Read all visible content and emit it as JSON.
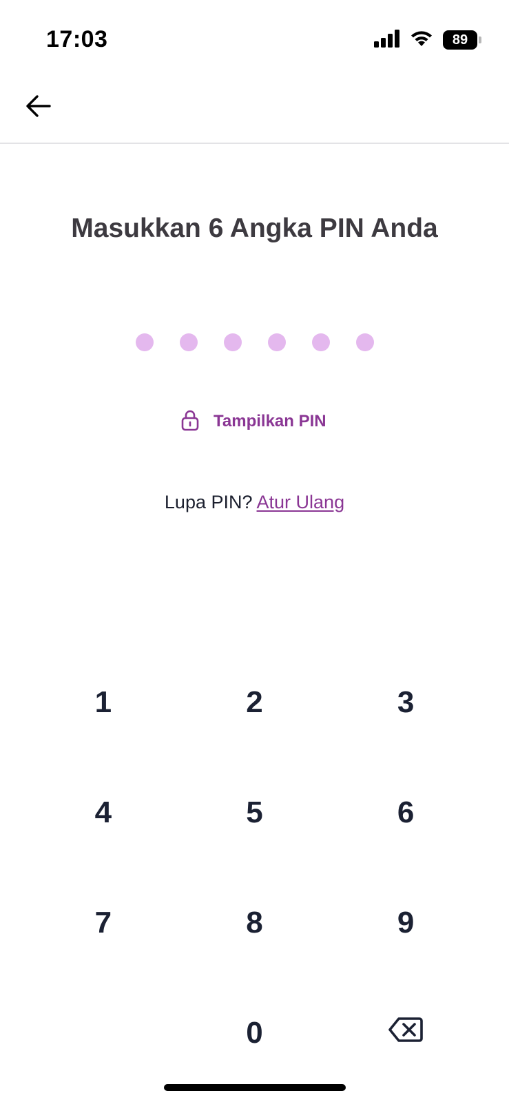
{
  "status_bar": {
    "time": "17:03",
    "battery_level": "89",
    "icons": [
      "signal-icon",
      "wifi-icon",
      "battery-icon"
    ]
  },
  "header": {
    "back_icon": "arrow-left-icon"
  },
  "title": "Masukkan 6 Angka PIN Anda",
  "pin": {
    "length": 6,
    "entered": 0,
    "dot_color": "#e4b8ee"
  },
  "show_pin": {
    "icon": "lock-icon",
    "label": "Tampilkan PIN"
  },
  "forgot": {
    "text": "Lupa PIN?",
    "link_label": "Atur Ulang"
  },
  "keypad": {
    "keys": [
      "1",
      "2",
      "3",
      "4",
      "5",
      "6",
      "7",
      "8",
      "9",
      "",
      "0",
      "backspace"
    ]
  },
  "colors": {
    "accent": "#8a3694",
    "title": "#3d3a40",
    "key_text": "#1b2133"
  }
}
